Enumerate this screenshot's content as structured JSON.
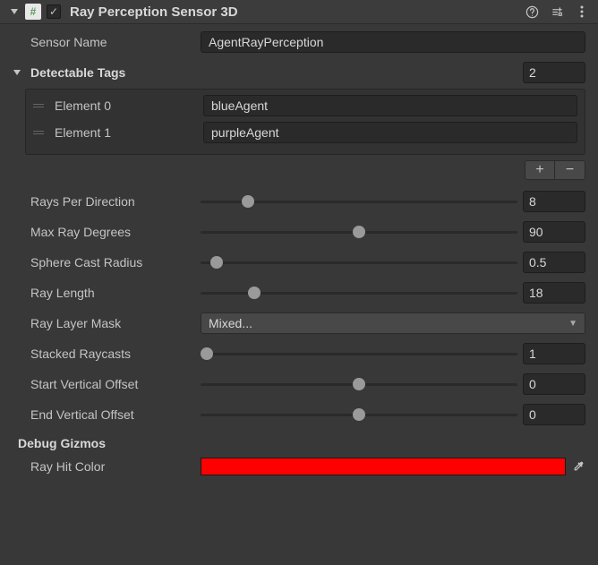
{
  "header": {
    "title": "Ray Perception Sensor 3D",
    "enabled": true
  },
  "fields": {
    "sensorName": {
      "label": "Sensor Name",
      "value": "AgentRayPerception"
    },
    "detectableTags": {
      "label": "Detectable Tags",
      "size": "2",
      "elements": [
        {
          "label": "Element 0",
          "value": "blueAgent"
        },
        {
          "label": "Element 1",
          "value": "purpleAgent"
        }
      ]
    },
    "raysPerDirection": {
      "label": "Rays Per Direction",
      "value": "8",
      "pct": 15
    },
    "maxRayDegrees": {
      "label": "Max Ray Degrees",
      "value": "90",
      "pct": 50
    },
    "sphereCastRadius": {
      "label": "Sphere Cast Radius",
      "value": "0.5",
      "pct": 5
    },
    "rayLength": {
      "label": "Ray Length",
      "value": "18",
      "pct": 17
    },
    "rayLayerMask": {
      "label": "Ray Layer Mask",
      "value": "Mixed..."
    },
    "stackedRaycasts": {
      "label": "Stacked Raycasts",
      "value": "1",
      "pct": 2
    },
    "startVerticalOffset": {
      "label": "Start Vertical Offset",
      "value": "0",
      "pct": 50
    },
    "endVerticalOffset": {
      "label": "End Vertical Offset",
      "value": "0",
      "pct": 50
    },
    "debugGizmos": {
      "label": "Debug Gizmos"
    },
    "rayHitColor": {
      "label": "Ray Hit Color",
      "color": "#ff0000"
    }
  }
}
